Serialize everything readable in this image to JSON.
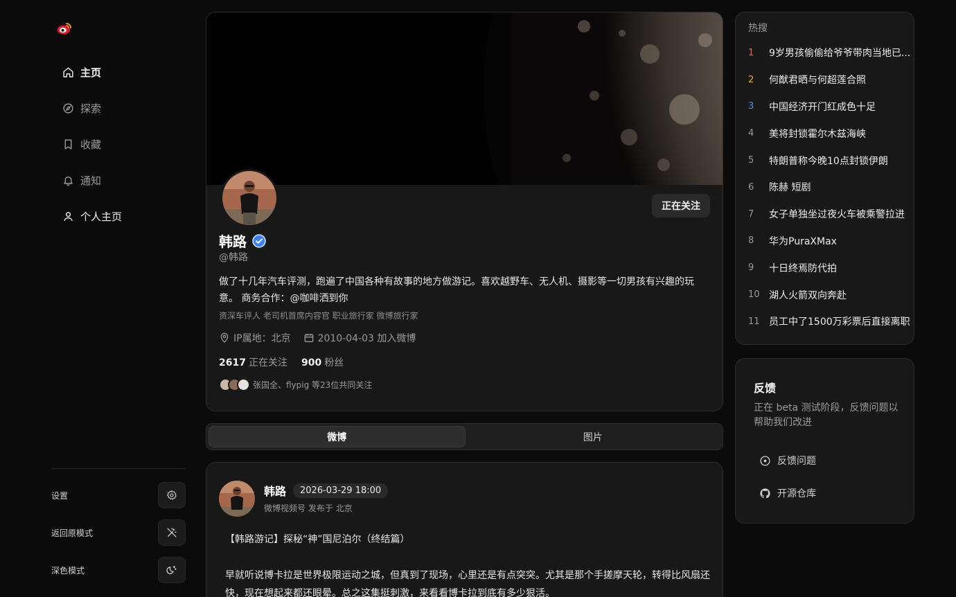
{
  "nav": {
    "items": [
      {
        "label": "主页",
        "icon": "home-icon",
        "active": true
      },
      {
        "label": "探索",
        "icon": "compass-icon"
      },
      {
        "label": "收藏",
        "icon": "bookmark-icon"
      },
      {
        "label": "通知",
        "icon": "bell-icon"
      },
      {
        "label": "个人主页",
        "icon": "user-icon"
      }
    ]
  },
  "settings": {
    "settings_label": "设置",
    "original_mode_label": "返回原模式",
    "dark_mode_label": "深色模式"
  },
  "profile": {
    "name": "韩路",
    "handle": "@韩路",
    "follow_button": "正在关注",
    "bio": "做了十几年汽车评测，跑遍了中国各种有故事的地方做游记。喜欢越野车、无人机、摄影等一切男孩有兴趣的玩意。 商务合作：@咖啡洒到你",
    "tags": "资深车评人 老司机首席内容官 职业旅行家 微博旅行家",
    "ip": "IP属地：北京",
    "joined": "2010-04-03 加入微博",
    "following_count": "2617",
    "following_label": "正在关注",
    "followers_count": "900",
    "followers_label": "粉丝",
    "mutual": "张国全、flypig 等23位共同关注"
  },
  "tabs": [
    {
      "label": "微博",
      "active": true
    },
    {
      "label": "图片",
      "active": false
    }
  ],
  "post": {
    "author": "韩路",
    "time": "2026-03-29 18:00",
    "source": "微博视频号 发布于 北京",
    "title": "【韩路游记】探秘“神”国尼泊尔（终结篇）",
    "body": "早就听说博卡拉是世界极限运动之城，但真到了现场，心里还是有点突突。尤其是那个手搓摩天轮，转得比风扇还快，现在想起来都还眼晕。总之这集挺刺激，来看看博卡拉到底有多少狠活。"
  },
  "hot": {
    "title": "热搜",
    "items": [
      {
        "rank": "1",
        "text": "9岁男孩偷偷给爷爷带肉当地已...",
        "color": "#f0653a"
      },
      {
        "rank": "2",
        "text": "何猷君晒与何超莲合照",
        "color": "#f5a623"
      },
      {
        "rank": "3",
        "text": "中国经济开门红成色十足",
        "color": "#4a90e2"
      },
      {
        "rank": "4",
        "text": "美将封锁霍尔木兹海峡",
        "color": "#9a9a9a"
      },
      {
        "rank": "5",
        "text": "特朗普称今晚10点封锁伊朗",
        "color": "#9a9a9a"
      },
      {
        "rank": "6",
        "text": "陈赫 短剧",
        "color": "#9a9a9a"
      },
      {
        "rank": "7",
        "text": "女子单独坐过夜火车被乘警拉进",
        "color": "#9a9a9a"
      },
      {
        "rank": "8",
        "text": "华为PuraXMax",
        "color": "#9a9a9a"
      },
      {
        "rank": "9",
        "text": "十日终焉防代拍",
        "color": "#9a9a9a"
      },
      {
        "rank": "10",
        "text": "湖人火箭双向奔赴",
        "color": "#9a9a9a"
      },
      {
        "rank": "11",
        "text": "员工中了1500万彩票后直接离职",
        "color": "#9a9a9a"
      }
    ]
  },
  "feedback": {
    "title": "反馈",
    "desc": "正在 beta 测试阶段，反馈问题以帮助我们改进",
    "report": "反馈问题",
    "repo": "开源仓库"
  },
  "colors": {
    "accent_verified": "#3b82f6",
    "brand_red": "#e6162d"
  }
}
